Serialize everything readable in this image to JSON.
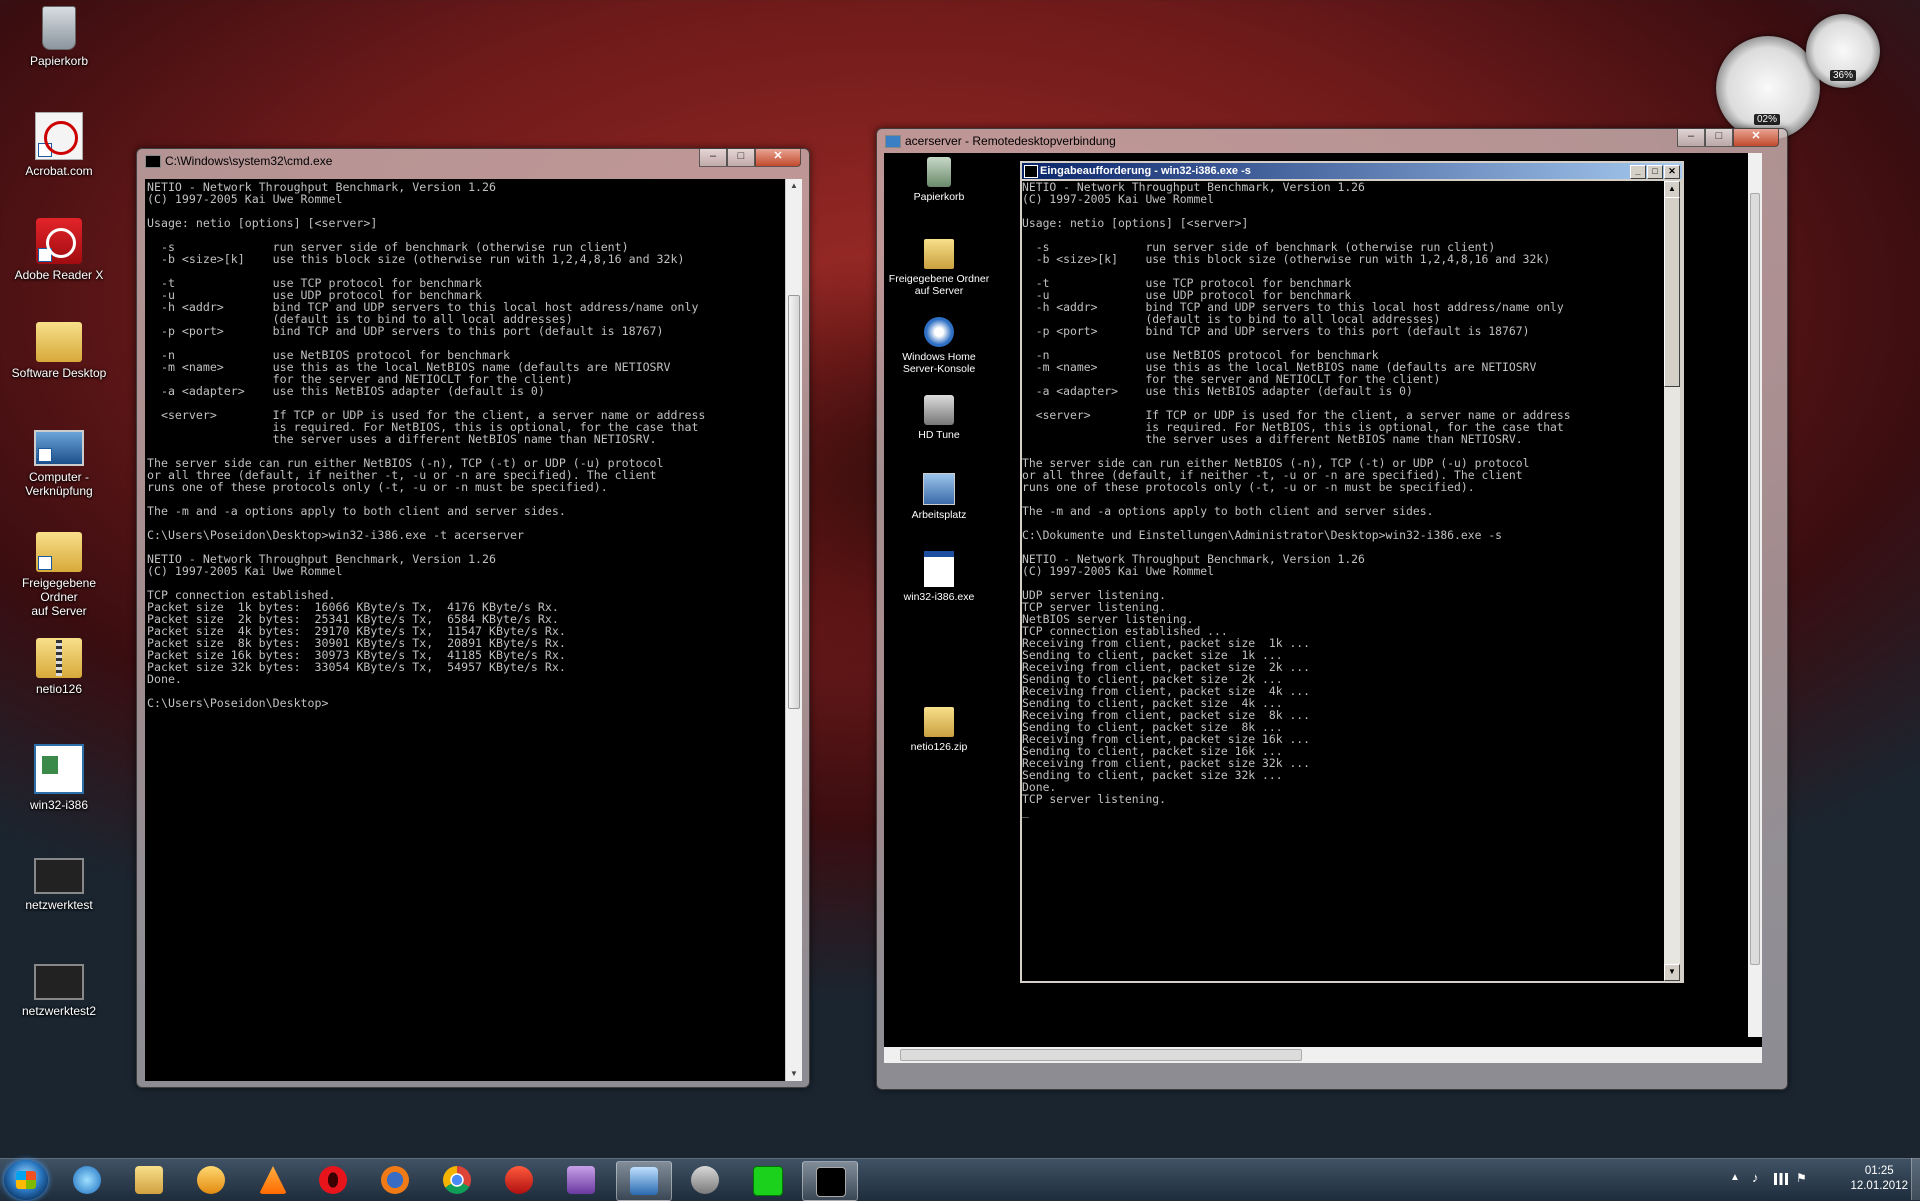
{
  "desktop": {
    "icons": [
      {
        "label": "Papierkorb"
      },
      {
        "label": "Acrobat.com"
      },
      {
        "label": "Adobe Reader X"
      },
      {
        "label": "Software Desktop"
      },
      {
        "label": "Computer -\nVerknüpfung"
      },
      {
        "label": "Freigegebene Ordner\nauf Server"
      },
      {
        "label": "netio126"
      },
      {
        "label": "win32-i386"
      },
      {
        "label": "netzwerktest"
      },
      {
        "label": "netzwerktest2"
      }
    ]
  },
  "cmd_window": {
    "title": "C:\\Windows\\system32\\cmd.exe",
    "content": "NETIO - Network Throughput Benchmark, Version 1.26\n(C) 1997-2005 Kai Uwe Rommel\n\nUsage: netio [options] [<server>]\n\n  -s              run server side of benchmark (otherwise run client)\n  -b <size>[k]    use this block size (otherwise run with 1,2,4,8,16 and 32k)\n\n  -t              use TCP protocol for benchmark\n  -u              use UDP protocol for benchmark\n  -h <addr>       bind TCP and UDP servers to this local host address/name only\n                  (default is to bind to all local addresses)\n  -p <port>       bind TCP and UDP servers to this port (default is 18767)\n\n  -n              use NetBIOS protocol for benchmark\n  -m <name>       use this as the local NetBIOS name (defaults are NETIOSRV\n                  for the server and NETIOCLT for the client)\n  -a <adapter>    use this NetBIOS adapter (default is 0)\n\n  <server>        If TCP or UDP is used for the client, a server name or address\n                  is required. For NetBIOS, this is optional, for the case that\n                  the server uses a different NetBIOS name than NETIOSRV.\n\nThe server side can run either NetBIOS (-n), TCP (-t) or UDP (-u) protocol\nor all three (default, if neither -t, -u or -n are specified). The client\nruns one of these protocols only (-t, -u or -n must be specified).\n\nThe -m and -a options apply to both client and server sides.\n\nC:\\Users\\Poseidon\\Desktop>win32-i386.exe -t acerserver\n\nNETIO - Network Throughput Benchmark, Version 1.26\n(C) 1997-2005 Kai Uwe Rommel\n\nTCP connection established.\nPacket size  1k bytes:  16066 KByte/s Tx,  4176 KByte/s Rx.\nPacket size  2k bytes:  25341 KByte/s Tx,  6584 KByte/s Rx.\nPacket size  4k bytes:  29170 KByte/s Tx,  11547 KByte/s Rx.\nPacket size  8k bytes:  30901 KByte/s Tx,  20891 KByte/s Rx.\nPacket size 16k bytes:  30973 KByte/s Tx,  41185 KByte/s Rx.\nPacket size 32k bytes:  33054 KByte/s Tx,  54957 KByte/s Rx.\nDone.\n\nC:\\Users\\Poseidon\\Desktop>"
  },
  "rdp_window": {
    "title": "acerserver - Remotedesktopverbindung",
    "desktop_icons": [
      {
        "label": "Papierkorb"
      },
      {
        "label": "Freigegebene Ordner\nauf Server"
      },
      {
        "label": "Windows Home\nServer-Konsole"
      },
      {
        "label": "HD Tune"
      },
      {
        "label": "Arbeitsplatz"
      },
      {
        "label": "win32-i386.exe"
      },
      {
        "label": "netio126.zip"
      }
    ],
    "inner_window": {
      "title": "Eingabeaufforderung - win32-i386.exe -s",
      "content": "NETIO - Network Throughput Benchmark, Version 1.26\n(C) 1997-2005 Kai Uwe Rommel\n\nUsage: netio [options] [<server>]\n\n  -s              run server side of benchmark (otherwise run client)\n  -b <size>[k]    use this block size (otherwise run with 1,2,4,8,16 and 32k)\n\n  -t              use TCP protocol for benchmark\n  -u              use UDP protocol for benchmark\n  -h <addr>       bind TCP and UDP servers to this local host address/name only\n                  (default is to bind to all local addresses)\n  -p <port>       bind TCP and UDP servers to this port (default is 18767)\n\n  -n              use NetBIOS protocol for benchmark\n  -m <name>       use this as the local NetBIOS name (defaults are NETIOSRV\n                  for the server and NETIOCLT for the client)\n  -a <adapter>    use this NetBIOS adapter (default is 0)\n\n  <server>        If TCP or UDP is used for the client, a server name or address\n                  is required. For NetBIOS, this is optional, for the case that\n                  the server uses a different NetBIOS name than NETIOSRV.\n\nThe server side can run either NetBIOS (-n), TCP (-t) or UDP (-u) protocol\nor all three (default, if neither -t, -u or -n are specified). The client\nruns one of these protocols only (-t, -u or -n must be specified).\n\nThe -m and -a options apply to both client and server sides.\n\nC:\\Dokumente und Einstellungen\\Administrator\\Desktop>win32-i386.exe -s\n\nNETIO - Network Throughput Benchmark, Version 1.26\n(C) 1997-2005 Kai Uwe Rommel\n\nUDP server listening.\nTCP server listening.\nNetBIOS server listening.\nTCP connection established ...\nReceiving from client, packet size  1k ...\nSending to client, packet size  1k ...\nReceiving from client, packet size  2k ...\nSending to client, packet size  2k ...\nReceiving from client, packet size  4k ...\nSending to client, packet size  4k ...\nReceiving from client, packet size  8k ...\nSending to client, packet size  8k ...\nReceiving from client, packet size 16k ...\nSending to client, packet size 16k ...\nReceiving from client, packet size 32k ...\nSending to client, packet size 32k ...\nDone.\nTCP server listening.\n_"
    }
  },
  "gadgets": {
    "cpu_value": "02%",
    "mem_value": "36%"
  },
  "taskbar": {
    "apps": [
      "internet-explorer",
      "explorer",
      "media-player",
      "vlc",
      "opera",
      "firefox",
      "chrome",
      "filezilla",
      "app-9",
      "remote-desktop",
      "app-11",
      "app-12",
      "cmd"
    ],
    "clock_time": "01:25",
    "clock_date": "12.01.2012"
  }
}
